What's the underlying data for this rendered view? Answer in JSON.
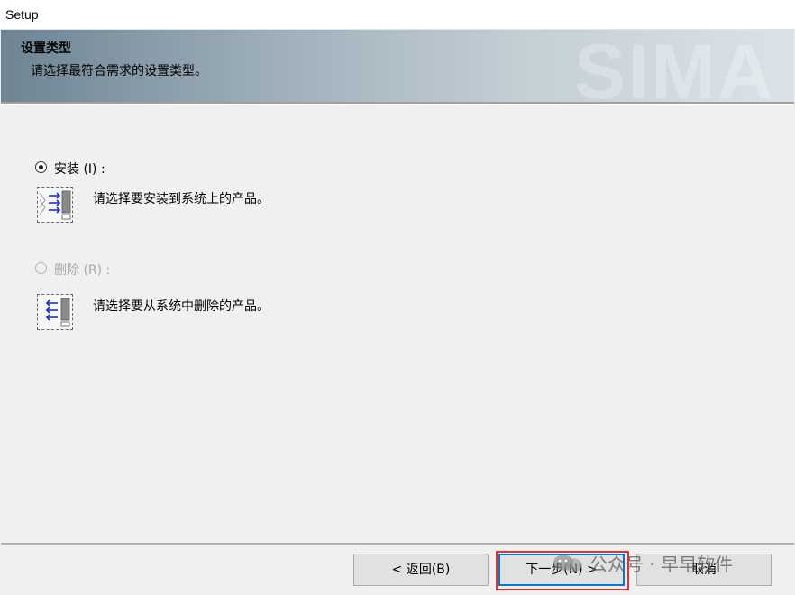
{
  "window": {
    "title": "Setup"
  },
  "header": {
    "title": "设置类型",
    "subtitle": "请选择最符合需求的设置类型。",
    "watermark": "SIMA"
  },
  "options": [
    {
      "label": "安装 (I) :",
      "description": "请选择要安装到系统上的产品。",
      "selected": true,
      "enabled": true
    },
    {
      "label": "删除 (R) :",
      "description": "请选择要从系统中删除的产品。",
      "selected": false,
      "enabled": false
    }
  ],
  "buttons": {
    "back": "< 返回(B)",
    "next": "下一步(N) >",
    "cancel": "取消"
  },
  "overlay_watermark": "公众号 · 早早软件",
  "colors": {
    "header_gradient_start": "#6e8494",
    "header_gradient_end": "#dbe3e8",
    "highlight_box": "#e03030",
    "primary_button_border": "#0078d7",
    "arrow_blue": "#1a2fd6"
  }
}
